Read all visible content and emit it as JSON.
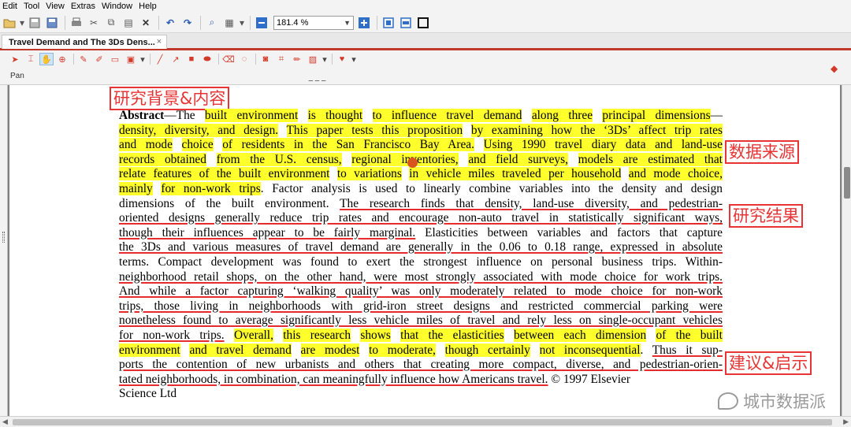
{
  "menu": [
    "Edit",
    "Tool",
    "View",
    "Extras",
    "Window",
    "Help"
  ],
  "toolbar": {
    "zoom_value": "181.4 %"
  },
  "tab": {
    "title": "Travel Demand and The 3Ds Dens...",
    "close": "×"
  },
  "panel": {
    "label": "Pan"
  },
  "doc_lines": [
    "<b>Abstract</b>—The <span class=\"hl\">built environment</span> <span class=\"hl\">is thought</span> <span class=\"hl\">to influence travel demand</span> <span class=\"hl\">along three</span> <span class=\"hl\">principal dimensions</span>—",
    "<span class=\"hl\">density, diversity, and design.</span> <span class=\"hl\">This paper tests this proposition</span> <span class=\"hl\">by examining how the ‘3Ds’ affect trip rates</span>",
    "<span class=\"hl\">and mode</span> <span class=\"hl\">choice</span> <span class=\"hl\">of residents in the San Francisco Bay Area.</span> <span class=\"hl\">Using 1990 travel diary data and land-use</span>",
    "<span class=\"hl\">records obtained</span> <span class=\"hl\">from the U.S. census,</span> <span class=\"hl\">regional inventories,</span> <span class=\"hl\">and field surveys,</span> <span class=\"hl\">models are estimated that</span>",
    "<span class=\"hl\">relate features of the built environment</span> <span class=\"hl\">to variations</span> <span class=\"hl\">in vehicle miles traveled per household</span> <span class=\"hl\">and mode choice,</span>",
    "<span class=\"hl\">mainly</span> <span class=\"hl\">for non-work trips</span>. Factor analysis is used to linearly combine variables into the density and design",
    "dimensions of the built environment. <span class=\"ul\">The research finds that density, land-use diversity, and pedestrian-</span>",
    "<span class=\"ul\">oriented designs generally reduce trip rates and encourage non-auto travel in statistically significant ways,</span>",
    "<span class=\"ul\">though their influences appear to be fairly marginal.</span> Elasticities between variables and factors that capture",
    "<span class=\"ul\">the 3Ds and various measures of travel demand are generally in the 0.06 to 0.18 range, expressed in absolute</span>",
    "terms. Compact development was found to exert the strongest influence on personal business trips. Within-",
    "<span class=\"ul\">neighborhood retail shops, on the other hand, were most strongly associated with mode choice for work trips.</span>",
    "<span class=\"ul\">And while a factor capturing ‘walking quality’ was only moderately related to mode choice for non-work</span>",
    "<span class=\"ul\">trips, those living in neighborhoods with grid-iron street designs and restricted commercial parking were</span>",
    "<span class=\"ul\">nonetheless found to average significantly less vehicle miles of travel and rely less on single-occupant vehicles</span>",
    "<span class=\"ul\">for non-work trips.</span> <span class=\"hl\">Overall,</span> <span class=\"hl\">this research</span> <span class=\"hl\">shows</span> <span class=\"hl\">that the elasticities</span> <span class=\"hl\">between each dimension</span> <span class=\"hl\">of the built</span>",
    "<span class=\"hl\">environment</span> <span class=\"hl\">and travel demand</span> <span class=\"hl\">are modest</span> <span class=\"hl\">to moderate,</span> <span class=\"hl\">though certainly</span> <span class=\"hl\">not inconsequential</span>. <span class=\"ul\">Thus it sup-</span>",
    "<span class=\"ul\">ports the contention of new urbanists and others that creating more compact, diverse, and pedestrian-orien-</span>",
    "<span class=\"ul\">tated neighborhoods, in combination, can meaningfully influence how Americans travel.</span> © 1997 Elsevier",
    "Science Ltd"
  ],
  "annotations": {
    "background": "研究背景&内容",
    "data_source": "数据来源",
    "results": "研究结果",
    "suggestions": "建议&启示"
  },
  "watermark": "城市数据派",
  "colors": {
    "highlight": "#ffff2b",
    "underline": "#e52b2b",
    "annotation": "#e83434",
    "tab_accent": "#c0392b"
  }
}
